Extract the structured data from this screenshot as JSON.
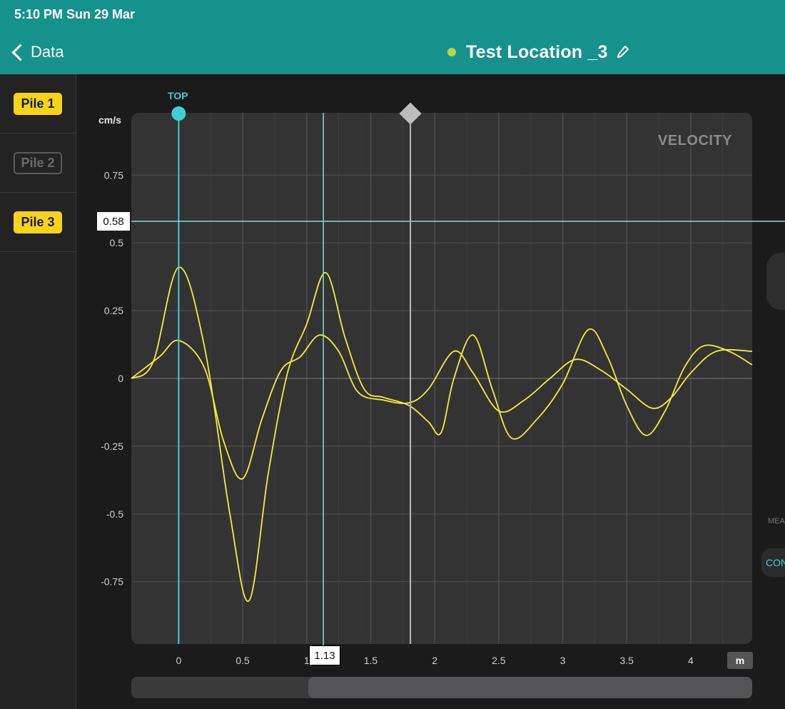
{
  "status_bar": {
    "time": "5:10 PM  Sun 29 Mar"
  },
  "header": {
    "back_label": "Data",
    "title": "Test Location _3",
    "status_dot_color": "#b5d64a",
    "accent_color": "#14928b"
  },
  "sidebar": {
    "items": [
      {
        "label": "Pile 1",
        "state": "active"
      },
      {
        "label": "Pile 2",
        "state": "inactive"
      },
      {
        "label": "Pile 3",
        "state": "active"
      }
    ]
  },
  "chart": {
    "y_unit": "cm/s",
    "watermark": "VELOCITY",
    "top_marker_label": "TOP",
    "y_cursor_value": "0.58",
    "x_cursor_value": "1.13",
    "x_unit_button": "m"
  },
  "right_panel": {
    "button_text": "CON",
    "clipped_text": "MEA"
  },
  "chart_data": {
    "type": "line",
    "xlabel": "m",
    "ylabel": "cm/s",
    "xlim": [
      -0.37,
      4.48
    ],
    "ylim": [
      -0.98,
      0.98
    ],
    "x_ticks": [
      "0",
      "0.5",
      "1",
      "1.5",
      "2",
      "2.5",
      "3",
      "3.5",
      "4"
    ],
    "y_ticks": [
      "0.75",
      "0.5",
      "0.25",
      "0",
      "-0.25",
      "-0.5",
      "-0.75"
    ],
    "cursors": {
      "top_x": 0,
      "horizontal_y": 0.58,
      "vertical_x": 1.13,
      "marker_x": 1.81
    },
    "series": [
      {
        "color": "#f1ee3a",
        "points": [
          [
            -0.37,
            0.0
          ],
          [
            -0.2,
            0.06
          ],
          [
            0,
            0.41
          ],
          [
            0.2,
            0.12
          ],
          [
            0.4,
            -0.5
          ],
          [
            0.55,
            -0.82
          ],
          [
            0.7,
            -0.35
          ],
          [
            0.85,
            0.02
          ],
          [
            1.0,
            0.2
          ],
          [
            1.15,
            0.39
          ],
          [
            1.3,
            0.15
          ],
          [
            1.45,
            -0.04
          ],
          [
            1.6,
            -0.07
          ],
          [
            1.8,
            -0.1
          ],
          [
            1.95,
            -0.16
          ],
          [
            2.05,
            -0.2
          ],
          [
            2.15,
            0.0
          ],
          [
            2.3,
            0.16
          ],
          [
            2.45,
            -0.04
          ],
          [
            2.6,
            -0.22
          ],
          [
            2.8,
            -0.15
          ],
          [
            3.0,
            -0.02
          ],
          [
            3.2,
            0.18
          ],
          [
            3.35,
            0.08
          ],
          [
            3.5,
            -0.1
          ],
          [
            3.65,
            -0.21
          ],
          [
            3.8,
            -0.12
          ],
          [
            3.95,
            0.04
          ],
          [
            4.1,
            0.12
          ],
          [
            4.3,
            0.1
          ],
          [
            4.48,
            0.05
          ]
        ]
      },
      {
        "color": "#f1ee3a",
        "points": [
          [
            -0.37,
            0.0
          ],
          [
            -0.15,
            0.08
          ],
          [
            0,
            0.14
          ],
          [
            0.2,
            0.04
          ],
          [
            0.35,
            -0.23
          ],
          [
            0.5,
            -0.37
          ],
          [
            0.65,
            -0.15
          ],
          [
            0.8,
            0.03
          ],
          [
            0.95,
            0.08
          ],
          [
            1.1,
            0.16
          ],
          [
            1.25,
            0.1
          ],
          [
            1.4,
            -0.05
          ],
          [
            1.6,
            -0.08
          ],
          [
            1.8,
            -0.09
          ],
          [
            1.95,
            -0.04
          ],
          [
            2.15,
            0.1
          ],
          [
            2.3,
            0.02
          ],
          [
            2.5,
            -0.12
          ],
          [
            2.7,
            -0.08
          ],
          [
            2.9,
            0.0
          ],
          [
            3.1,
            0.07
          ],
          [
            3.3,
            0.03
          ],
          [
            3.5,
            -0.04
          ],
          [
            3.7,
            -0.11
          ],
          [
            3.85,
            -0.07
          ],
          [
            4.0,
            0.02
          ],
          [
            4.2,
            0.1
          ],
          [
            4.48,
            0.1
          ]
        ]
      }
    ]
  }
}
